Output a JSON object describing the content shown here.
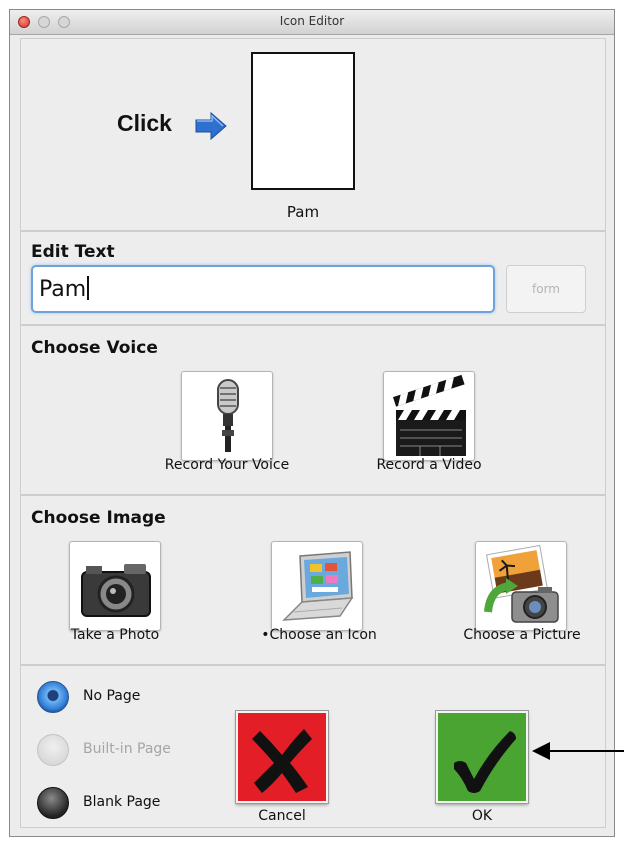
{
  "window": {
    "title": "Icon Editor"
  },
  "preview": {
    "click_label": "Click",
    "name": "Pam"
  },
  "edit_text": {
    "section_title": "Edit Text",
    "value": "Pam",
    "form_button": "form"
  },
  "choose_voice": {
    "section_title": "Choose Voice",
    "record_voice": "Record Your Voice",
    "record_video": "Record a Video"
  },
  "choose_image": {
    "section_title": "Choose Image",
    "take_photo": "Take a Photo",
    "choose_icon": "•Choose an Icon",
    "choose_picture": "Choose a Picture"
  },
  "page_options": {
    "no_page": "No Page",
    "builtin_page": "Built-in Page",
    "blank_page": "Blank Page",
    "selected": "No Page"
  },
  "actions": {
    "cancel": "Cancel",
    "ok": "OK"
  },
  "icons": {
    "click_arrow": "right-arrow-icon",
    "voice": "microphone-icon",
    "video": "clapperboard-icon",
    "photo": "camera-icon",
    "icon": "laptop-icon",
    "picture": "photo-camera-icon",
    "cancel": "cross-icon",
    "ok": "checkmark-icon"
  },
  "colors": {
    "cancel": "#e31e26",
    "ok": "#4aa431",
    "focus": "#6fa2d8",
    "radio_selected": "#2f7bd6"
  }
}
